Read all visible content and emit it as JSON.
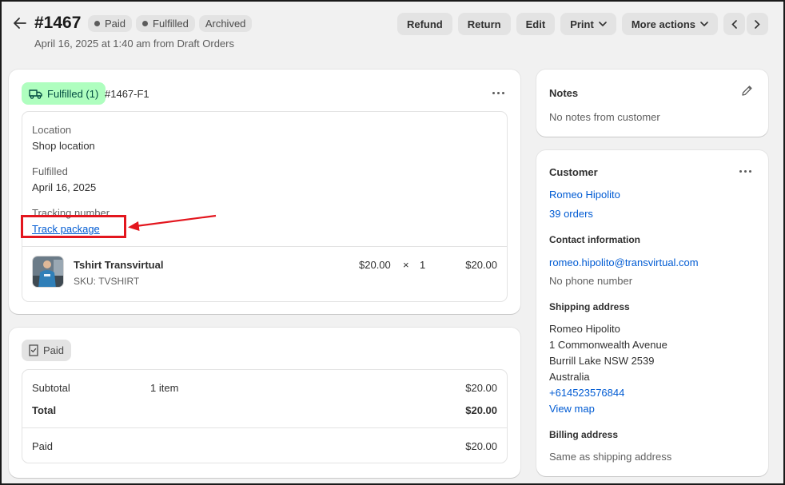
{
  "header": {
    "title": "#1467",
    "badges": [
      "Paid",
      "Fulfilled",
      "Archived"
    ],
    "subtitle": "April 16, 2025 at 1:40 am from Draft Orders",
    "actions": {
      "refund": "Refund",
      "return": "Return",
      "edit": "Edit",
      "print": "Print",
      "more": "More actions"
    }
  },
  "fulfillment": {
    "status": "Fulfilled (1)",
    "code": "#1467-F1",
    "location_label": "Location",
    "location_value": "Shop location",
    "fulfilled_label": "Fulfilled",
    "fulfilled_value": "April 16, 2025",
    "tracking_label": "Tracking number",
    "tracking_link": "Track package",
    "item": {
      "name": "Tshirt Transvirtual",
      "sku": "SKU: TVSHIRT",
      "price": "$20.00",
      "times": "×",
      "qty": "1",
      "total": "$20.00"
    }
  },
  "payment": {
    "status": "Paid",
    "subtotal_label": "Subtotal",
    "subtotal_items": "1 item",
    "subtotal_value": "$20.00",
    "total_label": "Total",
    "total_value": "$20.00",
    "paid_label": "Paid",
    "paid_value": "$20.00"
  },
  "notes": {
    "title": "Notes",
    "text": "No notes from customer"
  },
  "customer": {
    "title": "Customer",
    "name": "Romeo Hipolito",
    "orders": "39 orders",
    "contact_title": "Contact information",
    "email": "romeo.hipolito@transvirtual.com",
    "phone": "No phone number",
    "shipping_title": "Shipping address",
    "shipping_lines": [
      "Romeo Hipolito",
      "1 Commonwealth Avenue",
      "Burrill Lake NSW 2539",
      "Australia"
    ],
    "shipping_phone": "+614523576844",
    "view_map": "View map",
    "billing_title": "Billing address",
    "billing_text": "Same as shipping address"
  },
  "colors": {
    "accent_link": "#005bd3",
    "fulfilled_bg": "#affebf",
    "annotation_red": "#e3161e"
  }
}
